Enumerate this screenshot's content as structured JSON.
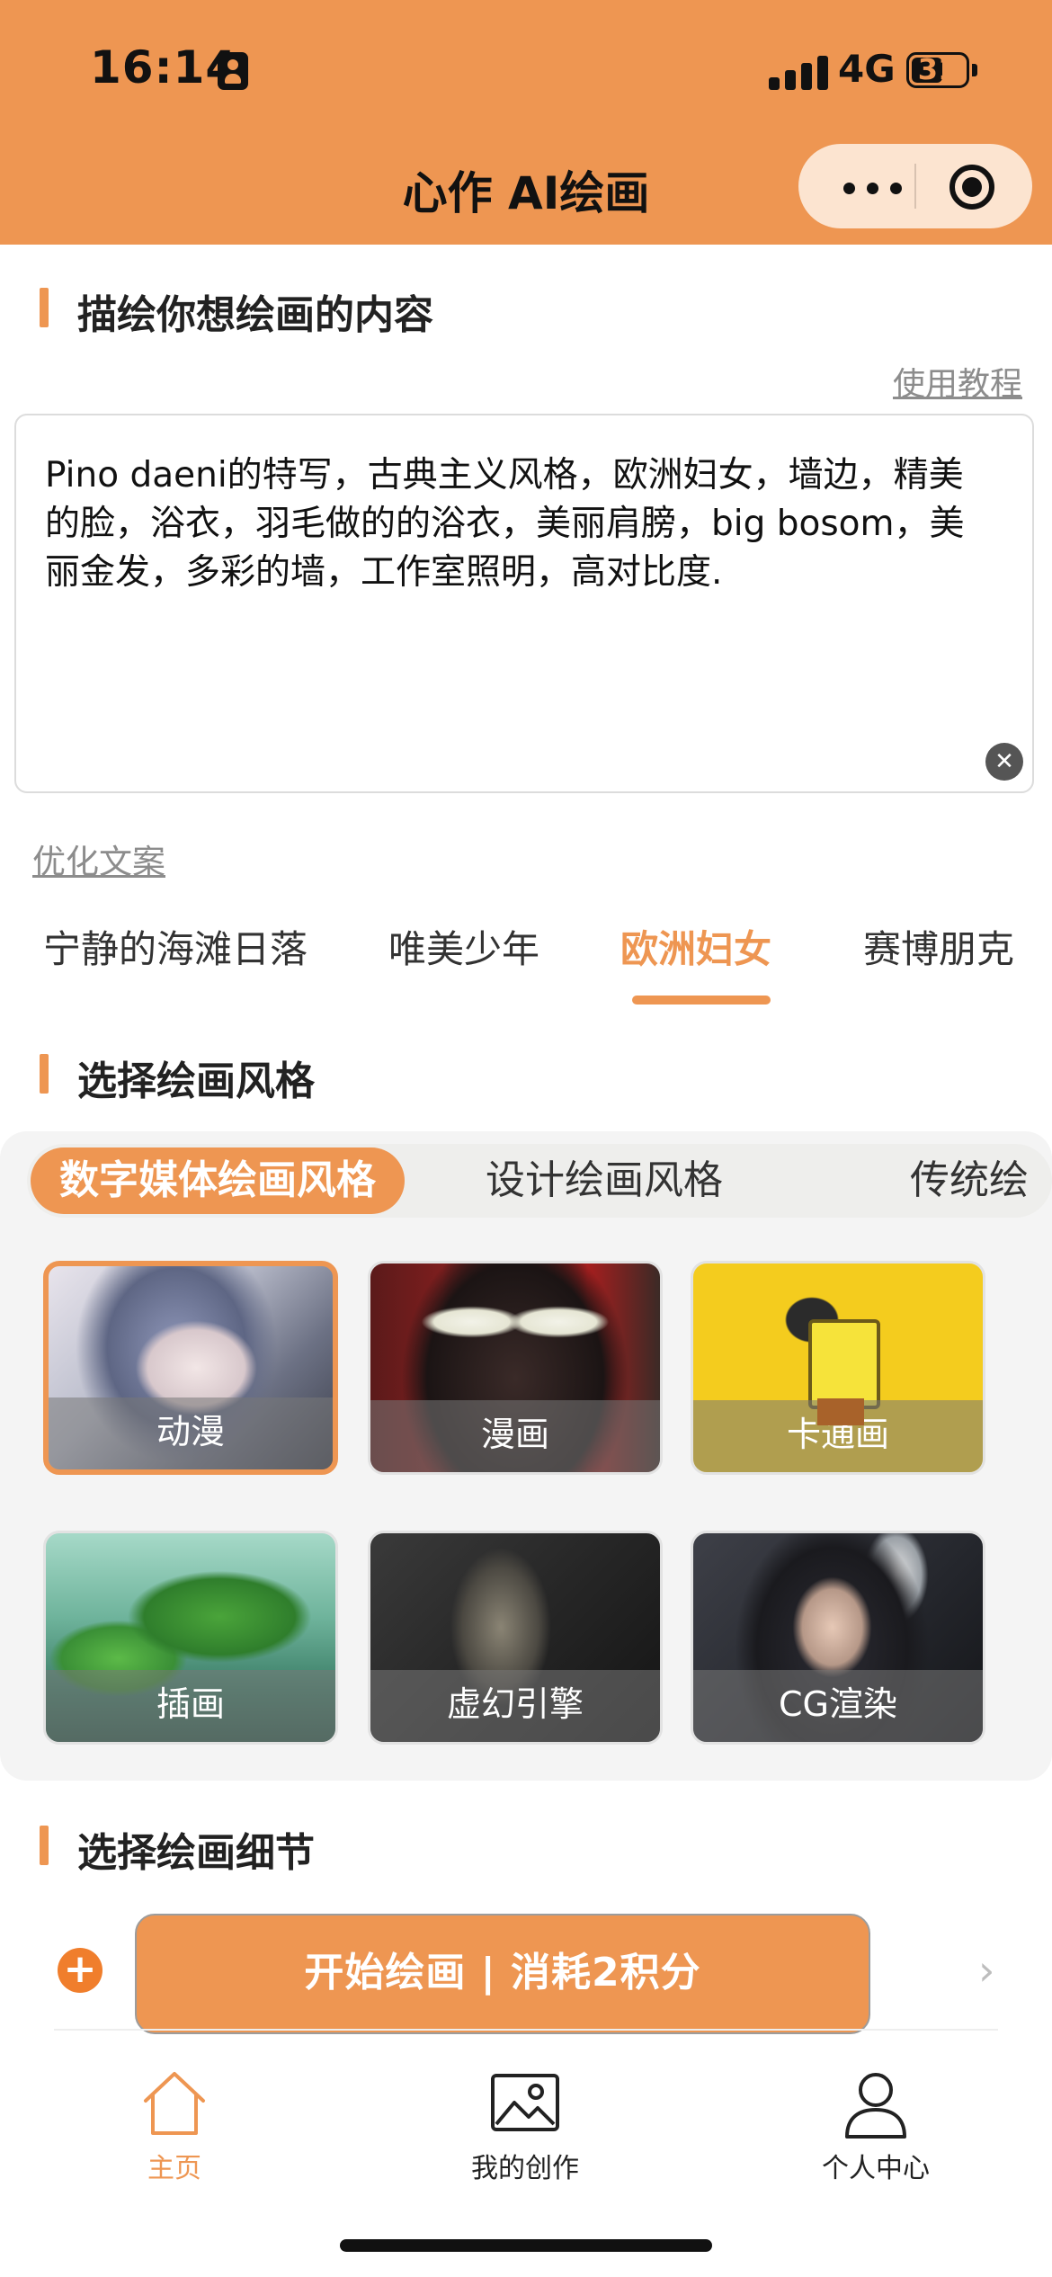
{
  "status_bar": {
    "time": "16:14",
    "network": "4G",
    "battery": "31"
  },
  "header": {
    "title": "心作 AI绘画"
  },
  "icons": {
    "person_badge": "person-badge-icon",
    "more": "more-dots-icon",
    "close": "target-close-icon",
    "clear": "clear-icon",
    "plus": "plus-icon",
    "chevron": "chevron-right-icon",
    "home": "home-icon",
    "creations": "image-icon",
    "profile": "user-icon"
  },
  "describe": {
    "title": "描绘你想绘画的内容",
    "tutorial_link": "使用教程",
    "prompt_value": "Pino daeni的特写，古典主义风格，欧洲妇女，墙边，精美的脸，浴衣，羽毛做的的浴衣，美丽肩膀，big bosom，美丽金发，多彩的墙，工作室照明，高对比度.",
    "clear_symbol": "✕",
    "optimize_link": "优化文案"
  },
  "preset_tabs": [
    {
      "label": "宁静的海滩日落",
      "active": false
    },
    {
      "label": "唯美少年",
      "active": false
    },
    {
      "label": "欧洲妇女",
      "active": true
    },
    {
      "label": "赛博朋克",
      "active": false
    }
  ],
  "style_section": {
    "title": "选择绘画风格",
    "categories": [
      {
        "label": "数字媒体绘画风格",
        "active": true
      },
      {
        "label": "设计绘画风格",
        "active": false
      },
      {
        "label": "传统绘",
        "active": false
      }
    ],
    "styles": [
      {
        "label": "动漫",
        "selected": true
      },
      {
        "label": "漫画",
        "selected": false
      },
      {
        "label": "卡通画",
        "selected": false
      },
      {
        "label": "插画",
        "selected": false
      },
      {
        "label": "虚幻引擎",
        "selected": false
      },
      {
        "label": "CG渲染",
        "selected": false
      }
    ]
  },
  "detail_section": {
    "title": "选择绘画细节"
  },
  "action": {
    "plus_symbol": "+",
    "start_button": "开始绘画 | 消耗2积分",
    "chevron_symbol": "›"
  },
  "tabbar": {
    "items": [
      {
        "label": "主页",
        "active": true
      },
      {
        "label": "我的创作",
        "active": false
      },
      {
        "label": "个人中心",
        "active": false
      }
    ]
  },
  "colors": {
    "accent": "#EE9652",
    "header_bg": "#EE9652",
    "capsule_bg": "#FCE4D0",
    "panel_bg": "#f4f4f4",
    "plus": "#F07E2C"
  }
}
